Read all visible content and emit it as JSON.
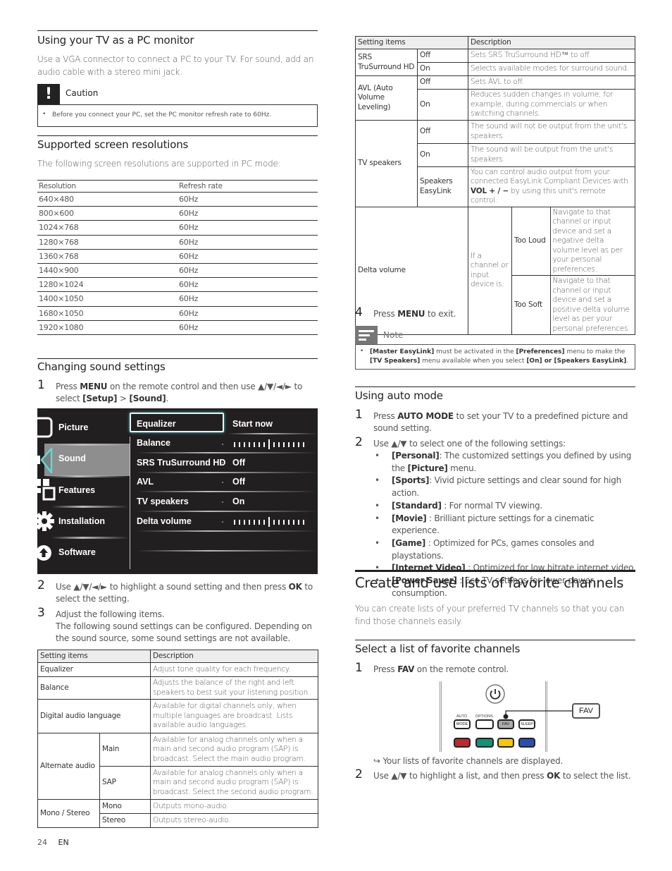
{
  "left": {
    "pc_monitor": {
      "title": "Using your TV as a PC monitor",
      "body": "Use a VGA connector to connect a PC to your TV. For sound, add an audio cable with a stereo mini jack.",
      "caution": {
        "icon": "exclamation-icon",
        "label": "Caution",
        "bullet": "Before you connect your PC, set the PC monitor refresh rate to 60Hz."
      }
    },
    "resolutions": {
      "title": "Supported screen resolutions",
      "intro": "The following screen resolutions are supported in PC mode:",
      "headers": [
        "Resolution",
        "Refresh rate"
      ],
      "rows": [
        [
          "640×480",
          "60Hz"
        ],
        [
          "800×600",
          "60Hz"
        ],
        [
          "1024×768",
          "60Hz"
        ],
        [
          "1280×768",
          "60Hz"
        ],
        [
          "1360×768",
          "60Hz"
        ],
        [
          "1440×900",
          "60Hz"
        ],
        [
          "1280×1024",
          "60Hz"
        ],
        [
          "1400×1050",
          "60Hz"
        ],
        [
          "1680×1050",
          "60Hz"
        ],
        [
          "1920×1080",
          "60Hz"
        ]
      ]
    },
    "sound": {
      "title": "Changing sound settings",
      "step1": {
        "num": "1",
        "pre": "Press ",
        "b1": "MENU",
        "mid": " on the remote control and then use ▲/▼/◄/► to select ",
        "b2": "[Setup]",
        "gt": " > ",
        "b3": "[Sound]",
        "post": "."
      },
      "step2": {
        "num": "2",
        "pre": "Use ▲/▼/◄/► to highlight a sound setting and then press ",
        "b1": "OK",
        "post": " to select the setting."
      },
      "step3": {
        "num": "3",
        "line1": "Adjust the following items.",
        "line2": "The following sound settings can be configured. Depending on the sound source, some sound settings are not available."
      }
    },
    "tv_menu": {
      "sidebar": [
        {
          "label": "Picture",
          "icon": "tv-screen-icon"
        },
        {
          "label": "Sound",
          "icon": "speaker-icon",
          "selected": true
        },
        {
          "label": "Features",
          "icon": "grid-icon"
        },
        {
          "label": "Installation",
          "icon": "gear-icon"
        },
        {
          "label": "Software",
          "icon": "upload-arrow-icon"
        }
      ],
      "options": [
        {
          "label": "Equalizer",
          "value": "Start now",
          "selected": true
        },
        {
          "label": "Balance",
          "value": "",
          "slider": 0.5
        },
        {
          "label": "SRS TruSurround HD",
          "value": "Off"
        },
        {
          "label": "AVL",
          "value": "Off"
        },
        {
          "label": "TV speakers",
          "value": "On"
        },
        {
          "label": "Delta volume",
          "value": "",
          "slider": 0.5
        }
      ]
    },
    "settings_table": {
      "headers": [
        "Setting items",
        "Description"
      ],
      "equalizer": {
        "item": "Equalizer",
        "desc": "Adjust tone quality for each frequency."
      },
      "balance": {
        "item": "Balance",
        "desc": "Adjusts the balance of the right and left speakers to best suit your listening position."
      },
      "digital": {
        "item": "Digital audio language",
        "desc": "Available for digital channels only, when multiple languages are broadcast. Lists available audio languages."
      },
      "alternate": {
        "item": "Alternate audio",
        "main": "Main",
        "main_desc": "Available for analog channels only when a main and second audio program (SAP) is broadcast. Select the main audio program.",
        "sap": "SAP",
        "sap_desc": "Available for analog channels only when a main and second audio program (SAP) is broadcast. Select the second audio program."
      },
      "mono": {
        "item": "Mono / Stereo",
        "mono": "Mono",
        "mono_desc": "Outputs mono-audio.",
        "stereo": "Stereo",
        "stereo_desc": "Outputs stereo-audio."
      }
    },
    "footer": {
      "page": "24",
      "lang": "EN"
    }
  },
  "right": {
    "table": {
      "headers": [
        "Setting items",
        "Description"
      ],
      "srs": {
        "item": "SRS TruSurround HD",
        "off": "Off",
        "off_desc": "Sets SRS TruSurround HD™ to off.",
        "on": "On",
        "on_desc": "Selects available modes for surround sound."
      },
      "avl": {
        "item": "AVL (Auto Volume Leveling)",
        "off": "Off",
        "off_desc": "Sets AVL to off.",
        "on": "On",
        "on_desc": "Reduces sudden changes in volume, for example, during commercials or when switching channels."
      },
      "speakers": {
        "item": "TV speakers",
        "off": "Off",
        "off_desc": "The sound will not be output from the unit's speakers.",
        "on": "On",
        "on_desc": "The sound will be output from the unit's speakers.",
        "easy": "Speakers EasyLink",
        "easy_desc_pre": "You can control audio output from your connected EasyLink Compliant Devices with ",
        "easy_desc_b": "VOL + / −",
        "easy_desc_post": " by using this unit's remote control."
      },
      "delta": {
        "item": "Delta volume",
        "cond": "If a channel or input device is:",
        "loud": "Too Loud",
        "loud_desc": "Navigate to that channel or input device and set a negative delta volume level as per your personal preferences.",
        "soft": "Too Soft",
        "soft_desc": "Navigate to that channel or input device and set a positive delta volume level as per your personal preferences."
      }
    },
    "step4": {
      "num": "4",
      "pre": "Press ",
      "b1": "MENU",
      "post": " to exit."
    },
    "note": {
      "label": "Note",
      "b1": "[Master EasyLink]",
      "t1": " must be activated in the ",
      "b2": "[Preferences]",
      "t2": " menu to make the ",
      "b3": "[TV Speakers]",
      "t3": " menu available when you select ",
      "b4": "[On] or [Speakers EasyLink]",
      "t4": "."
    },
    "auto_mode": {
      "title": "Using auto mode",
      "step1": {
        "num": "1",
        "pre": "Press ",
        "b1": "AUTO MODE",
        "post": " to set your TV to a predefined picture and sound setting."
      },
      "step2": {
        "num": "2",
        "text": "Use ▲/▼ to select one of the following settings:"
      },
      "items": [
        {
          "b": "[Personal]",
          "t": ": The customized settings you defined by using the ",
          "b2": "[Picture]",
          "t2": " menu."
        },
        {
          "b": "[Sports]",
          "t": ": Vivid picture settings and clear sound for high action."
        },
        {
          "b": "[Standard]",
          "t": " : For normal TV viewing."
        },
        {
          "b": "[Movie]",
          "t": " : Brilliant picture settings for a cinematic experience."
        },
        {
          "b": "[Game]",
          "t": " : Optimized for PCs, games consoles and playstations."
        },
        {
          "b": "[Internet Video]",
          "t": " : Optimized for low bitrate internet video."
        },
        {
          "b": "[Power Saver]",
          "t": " : Eco TV settings for lower power consumption."
        }
      ]
    },
    "favorites": {
      "title": "Create and use lists of favorite channels",
      "body": "You can create lists of your preferred TV channels so that you can find those channels easily.",
      "sub": "Select a list of favorite channels",
      "step1": {
        "num": "1",
        "pre": "Press ",
        "b1": "FAV",
        "post": " on the remote control."
      },
      "remote": {
        "auto": "AUTO",
        "mode": "MODE",
        "options": "OPTIONS",
        "fav": "FAV",
        "sleep": "SLEEP",
        "callout": "FAV",
        "colors": [
          "#c0272d",
          "#0f9474",
          "#f5c800",
          "#2b4eb3"
        ]
      },
      "result": "Your lists of favorite channels are displayed.",
      "step2": {
        "num": "2",
        "pre": "Use ▲/▼ to highlight a list, and then press ",
        "b1": "OK",
        "post": " to select the list."
      }
    }
  }
}
